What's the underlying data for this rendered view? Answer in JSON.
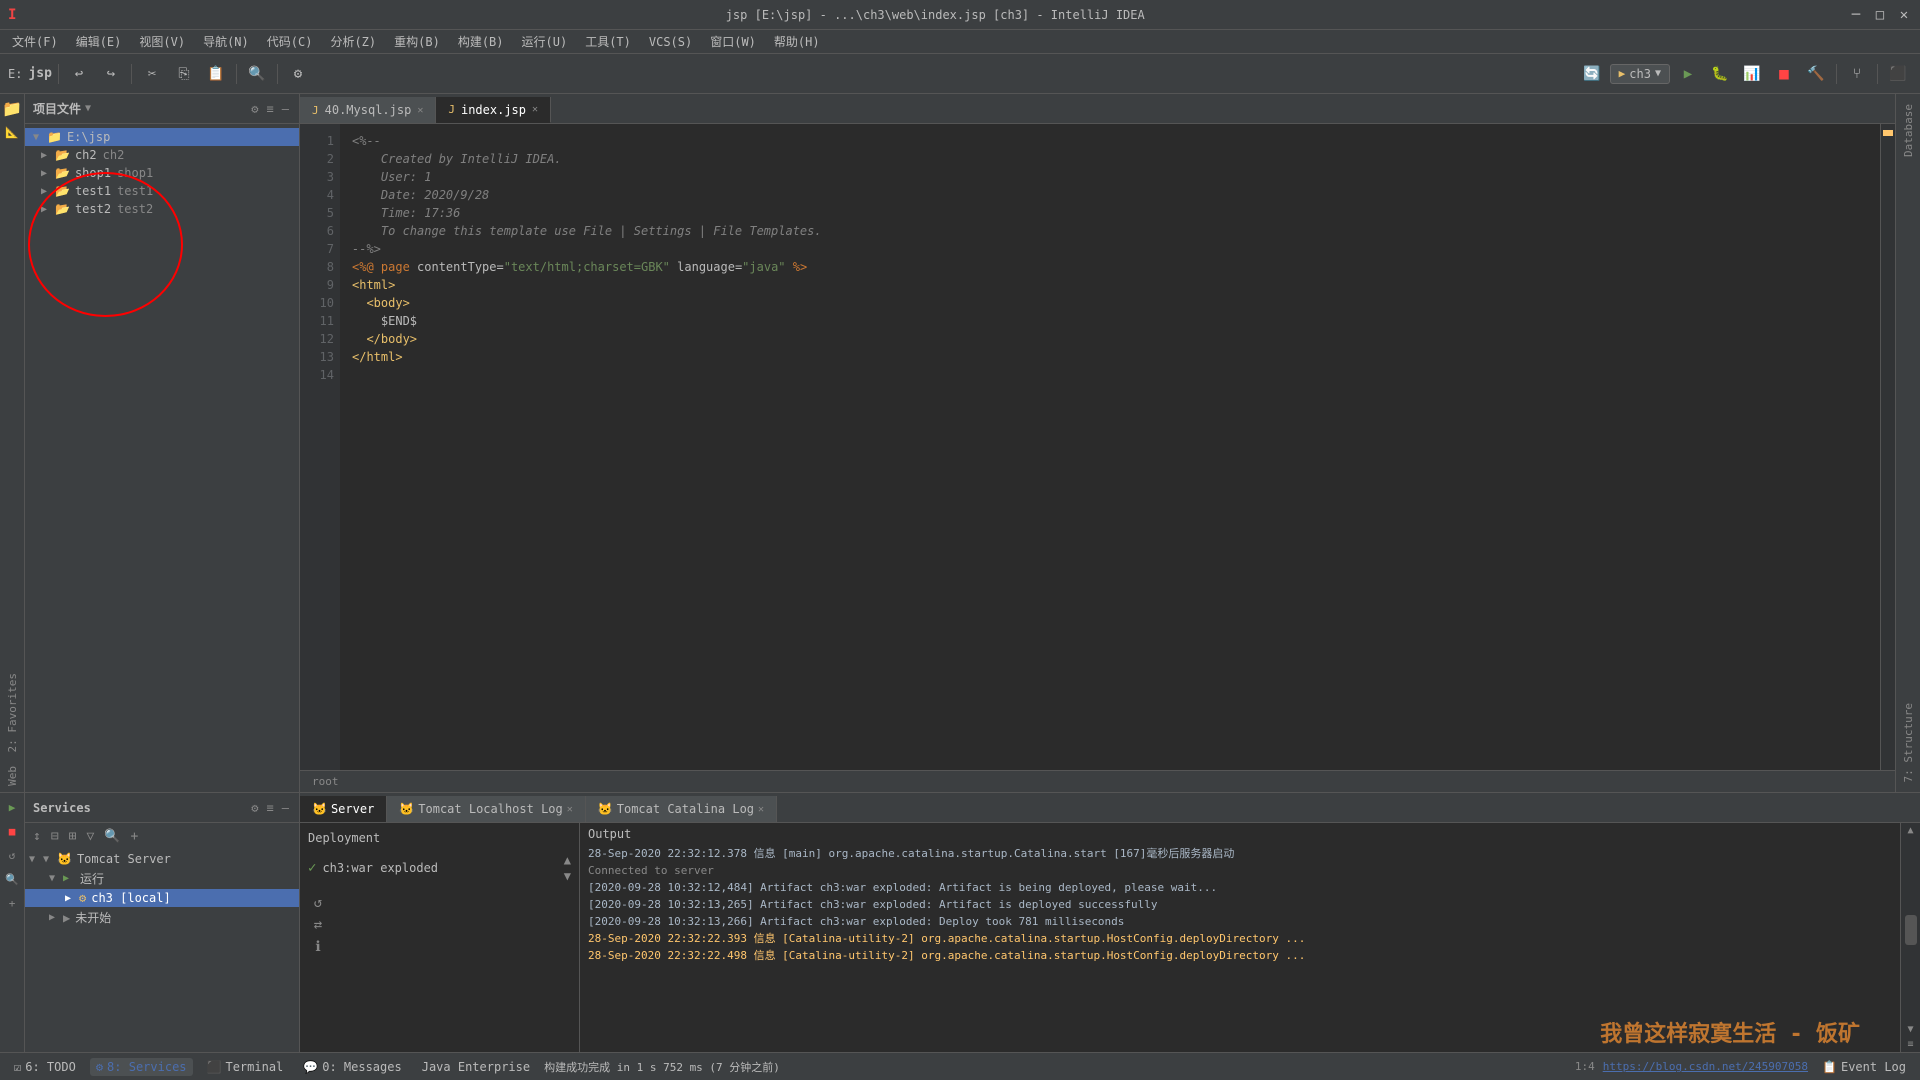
{
  "titleBar": {
    "title": "jsp [E:\\jsp] - ...\\ch3\\web\\index.jsp [ch3] - IntelliJ IDEA",
    "driveLabel": "E:",
    "projectLabel": "jsp",
    "minimizeIcon": "─",
    "maximizeIcon": "□",
    "closeIcon": "✕"
  },
  "menuBar": {
    "items": [
      "文件(F)",
      "编辑(E)",
      "视图(V)",
      "导航(N)",
      "代码(C)",
      "分析(Z)",
      "重构(B)",
      "构建(B)",
      "运行(U)",
      "工具(T)",
      "VCS(S)",
      "窗口(W)",
      "帮助(H)"
    ]
  },
  "toolbar": {
    "runConfig": "ch3",
    "projectDrive": "E:",
    "projectName": "jsp"
  },
  "projectPanel": {
    "title": "项目文件",
    "items": [
      {
        "label": "E:\\jsp",
        "icon": "📁",
        "level": 0,
        "selected": true
      },
      {
        "label": "ch2",
        "secondary": "ch2",
        "icon": "📁",
        "level": 1,
        "selected": false
      },
      {
        "label": "shop1",
        "secondary": "shop1",
        "icon": "📁",
        "level": 1,
        "selected": false
      },
      {
        "label": "test1",
        "secondary": "test1",
        "icon": "📁",
        "level": 1,
        "selected": false
      },
      {
        "label": "test2",
        "secondary": "test2",
        "icon": "📁",
        "level": 1,
        "selected": false
      }
    ]
  },
  "editorTabs": [
    {
      "label": "40.Mysql.jsp",
      "icon": "J",
      "active": false,
      "closeable": true
    },
    {
      "label": "index.jsp",
      "icon": "J",
      "active": true,
      "closeable": true
    }
  ],
  "codeLines": [
    {
      "num": 1,
      "content": "<%--"
    },
    {
      "num": 2,
      "content": "    Created by IntelliJ IDEA."
    },
    {
      "num": 3,
      "content": "    User: 1"
    },
    {
      "num": 4,
      "content": "    Date: 2020/9/28"
    },
    {
      "num": 5,
      "content": "    Time: 17:36"
    },
    {
      "num": 6,
      "content": "    To change this template use File | Settings | File Templates."
    },
    {
      "num": 7,
      "content": "--%>"
    },
    {
      "num": 8,
      "content": "<%@ page contentType=\"text/html;charset=GBK\" language=\"java\" %>"
    },
    {
      "num": 9,
      "content": "<html>"
    },
    {
      "num": 10,
      "content": "  <body>"
    },
    {
      "num": 11,
      "content": "    $END$"
    },
    {
      "num": 12,
      "content": "  </body>"
    },
    {
      "num": 13,
      "content": "</html>"
    },
    {
      "num": 14,
      "content": ""
    }
  ],
  "editorBottom": {
    "cursorInfo": "root"
  },
  "servicesPanel": {
    "title": "Services",
    "tabs": [
      "Server",
      "Tomcat Localhost Log",
      "Tomcat Catalina Log"
    ],
    "activeTab": 0,
    "tree": {
      "tomcatServer": "Tomcat Server",
      "running": "运行",
      "ch3Local": "ch3 [local]",
      "notStarted": "未开始"
    },
    "deployment": {
      "header": "Deployment",
      "items": [
        "ch3:war exploded"
      ]
    },
    "output": {
      "header": "Output",
      "lines": [
        {
          "text": "28-Sep-2020 22:32:12.378 信息 [main] org.apache.catalina.startup.Catalina.start [167]毫秒后服务器启动",
          "type": "info"
        },
        {
          "text": "Connected to server",
          "type": "gray"
        },
        {
          "text": "[2020-09-28 10:32:12,484] Artifact ch3:war exploded: Artifact is being deployed, please wait...",
          "type": "info"
        },
        {
          "text": "[2020-09-28 10:32:13,265] Artifact ch3:war exploded: Artifact is deployed successfully",
          "type": "info"
        },
        {
          "text": "[2020-09-28 10:32:13,266] Artifact ch3:war exploded: Deploy took 781 milliseconds",
          "type": "info"
        },
        {
          "text": "28-Sep-2020 22:32:22.393 信息 [Catalina-utility-2] org.apache.catalina.startup.HostConfig.deployDirectory ...",
          "type": "warn"
        },
        {
          "text": "28-Sep-2020 22:32:22.498 信息 [Catalina-utility-2] org.apache.catalina.startup.HostConfig.deployDirectory ...",
          "type": "warn"
        }
      ]
    }
  },
  "statusBar": {
    "buildStatus": "构建成功完成 in 1 s 752 ms (7 分钟之前)",
    "tabs": [
      "6: TODO",
      "8: Services",
      "Terminal",
      "0: Messages",
      "Java Enterprise"
    ],
    "rightInfo": "1:4  https://blog.csdn.net/245907058",
    "eventLog": "Event Log"
  },
  "watermark": "我曾这样寂寞生活 - 饭矿"
}
